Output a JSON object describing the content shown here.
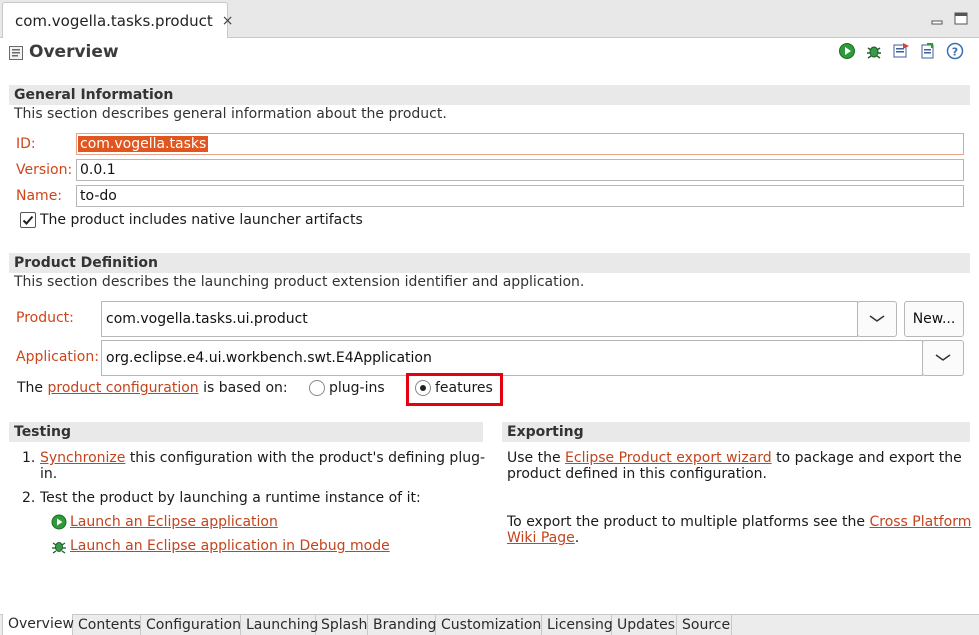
{
  "editor_tab": {
    "title": "com.vogella.tasks.product",
    "close": "×"
  },
  "header": {
    "title": "Overview"
  },
  "general": {
    "title": "General Information",
    "description": "This section describes general information about the product.",
    "id_label": "ID:",
    "id_value": "com.vogella.tasks",
    "version_label": "Version:",
    "version_value": "0.0.1",
    "name_label": "Name:",
    "name_value": "to-do",
    "launcher_checkbox_label": "The product includes native launcher artifacts",
    "launcher_checked": true
  },
  "definition": {
    "title": "Product Definition",
    "description": "This section describes the launching product extension identifier and application.",
    "product_label": "Product:",
    "product_value": "com.vogella.tasks.ui.product",
    "new_button": "New...",
    "application_label": "Application:",
    "application_value": "org.eclipse.e4.ui.workbench.swt.E4Application",
    "config_prefix": "The",
    "config_link": "product configuration",
    "config_suffix": "is based on:",
    "radio_plugins": "plug-ins",
    "radio_features": "features",
    "selected": "features"
  },
  "testing": {
    "title": "Testing",
    "step1_num": "1.",
    "step1_link": "Synchronize",
    "step1_text_a": "this configuration with the product's defining plug-",
    "step1_text_b": "in.",
    "step2_num": "2.",
    "step2_text": "Test the product by launching a runtime instance of it:",
    "launch_link": "Launch an Eclipse application",
    "debug_link": "Launch an Eclipse application in Debug mode"
  },
  "exporting": {
    "title": "Exporting",
    "p1_prefix": "Use the",
    "p1_link": "Eclipse Product export wizard",
    "p1_suffix": "to package and export the",
    "p1_line2": "product defined in this configuration.",
    "p2_prefix": "To export the product to multiple platforms see the",
    "p2_link_a": "Cross Platform",
    "p2_link_b": "Wiki Page",
    "p2_suffix": "."
  },
  "page_tabs": [
    "Overview",
    "Contents",
    "Configuration",
    "Launching",
    "Splash",
    "Branding",
    "Customization",
    "Licensing",
    "Updates",
    "Source"
  ],
  "colors": {
    "link": "#c3441d",
    "label": "#d04419",
    "highlight": "#e3000f",
    "selection": "#e0561e"
  }
}
